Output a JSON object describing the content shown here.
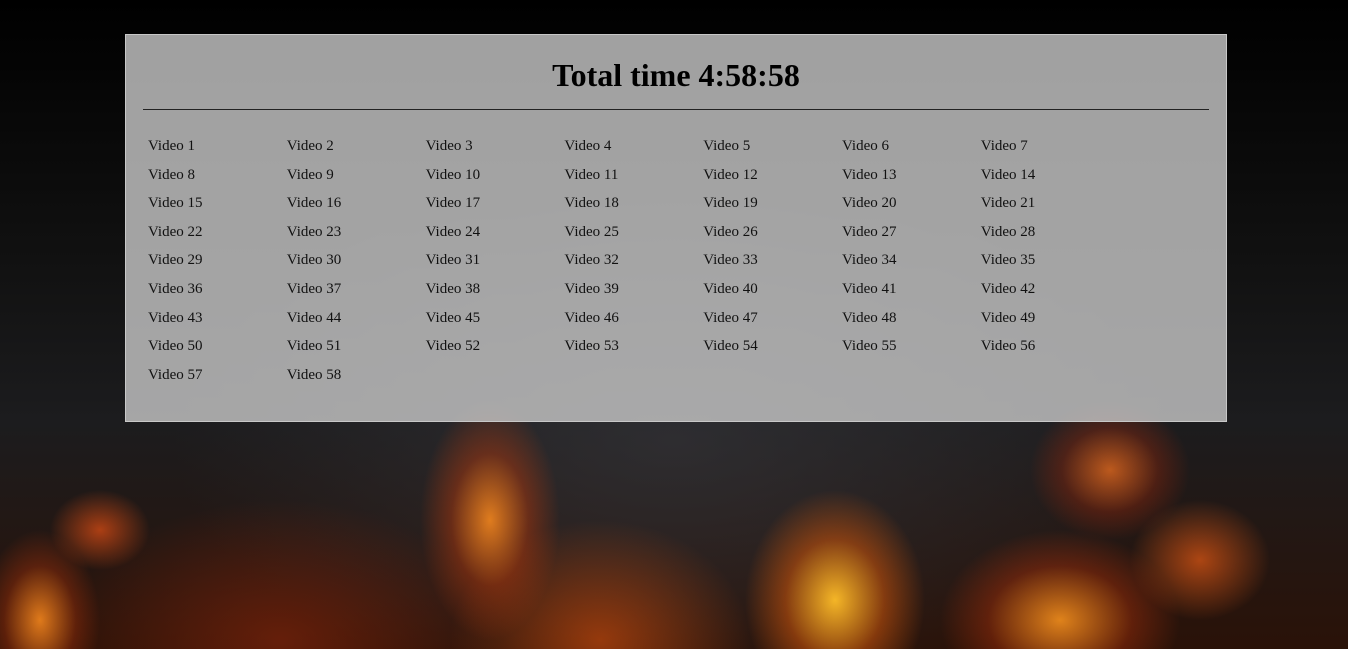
{
  "page": {
    "title": "Total time 4:58:58"
  },
  "videos": [
    "Video 1",
    "Video 2",
    "Video 3",
    "Video 4",
    "Video 5",
    "Video 6",
    "Video 7",
    "Video 8",
    "Video 9",
    "Video 10",
    "Video 11",
    "Video 12",
    "Video 13",
    "Video 14",
    "Video 15",
    "Video 16",
    "Video 17",
    "Video 18",
    "Video 19",
    "Video 20",
    "Video 21",
    "Video 22",
    "Video 23",
    "Video 24",
    "Video 25",
    "Video 26",
    "Video 27",
    "Video 28",
    "Video 29",
    "Video 30",
    "Video 31",
    "Video 32",
    "Video 33",
    "Video 34",
    "Video 35",
    "Video 36",
    "Video 37",
    "Video 38",
    "Video 39",
    "Video 40",
    "Video 41",
    "Video 42",
    "Video 43",
    "Video 44",
    "Video 45",
    "Video 46",
    "Video 47",
    "Video 48",
    "Video 49",
    "Video 50",
    "Video 51",
    "Video 52",
    "Video 53",
    "Video 54",
    "Video 55",
    "Video 56",
    "Video 57",
    "Video 58"
  ],
  "colors": {
    "panel_background": "#c4c4c4",
    "text": "#000000",
    "page_background": "#000000"
  }
}
